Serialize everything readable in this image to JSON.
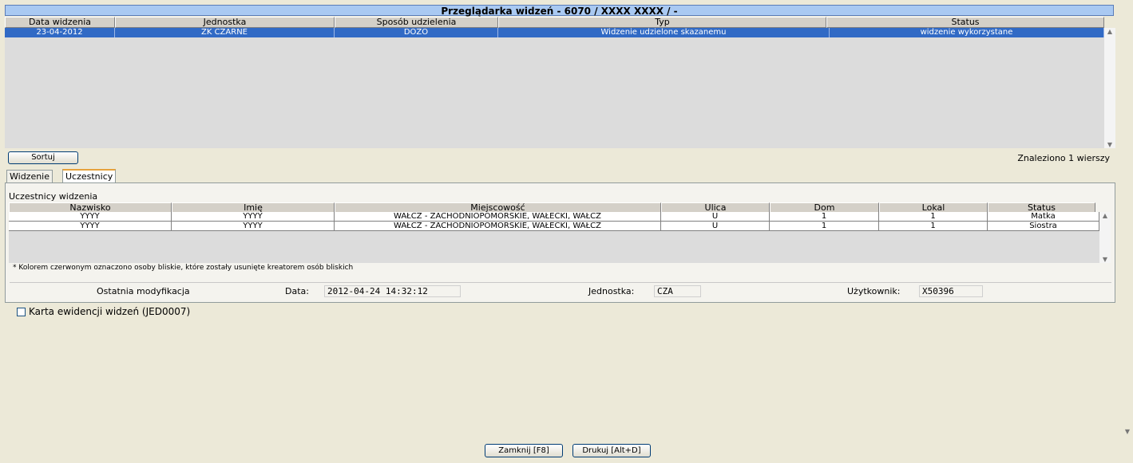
{
  "title": "Przeglądarka widzeń - 6070 / XXXX XXXX / -",
  "visits_table": {
    "columns": [
      "Data widzenia",
      "Jednostka",
      "Sposób udzielenia",
      "Typ",
      "Status"
    ],
    "rows": [
      [
        "23-04-2012",
        "ZK CZARNE",
        "DOZO",
        "Widzenie udzielone skazanemu",
        "widzenie wykorzystane"
      ]
    ]
  },
  "sort_button": "Sortuj",
  "found_text": "Znaleziono 1 wierszy",
  "tabs": [
    "Widzenie",
    "Uczestnicy"
  ],
  "participants": {
    "heading": "Uczestnicy widzenia",
    "columns": [
      "Nazwisko",
      "Imię",
      "Miejscowość",
      "Ulica",
      "Dom",
      "Lokal",
      "Status"
    ],
    "rows": [
      [
        "YYYY",
        "YYYY",
        "WAŁCZ - ZACHODNIOPOMORSKIE, WAŁECKI, WAŁCZ",
        "U",
        "1",
        "1",
        "Matka"
      ],
      [
        "YYYY",
        "YYYY",
        "WAŁCZ - ZACHODNIOPOMORSKIE, WAŁECKI, WAŁCZ",
        "U",
        "1",
        "1",
        "Siostra"
      ]
    ],
    "note": "* Kolorem czerwonym oznaczono osoby bliskie, które zostały usunięte kreatorem osób bliskich"
  },
  "modification": {
    "label": "Ostatnia modyfikacja",
    "date_label": "Data:",
    "date_value": "2012-04-24 14:32:12",
    "unit_label": "Jednostka:",
    "unit_value": "CZA",
    "user_label": "Użytkownik:",
    "user_value": "X50396"
  },
  "checkbox_label": "Karta ewidencji widzeń (JED0007)",
  "buttons": {
    "close": "Zamknij [F8]",
    "print": "Drukuj [Alt+D]"
  }
}
